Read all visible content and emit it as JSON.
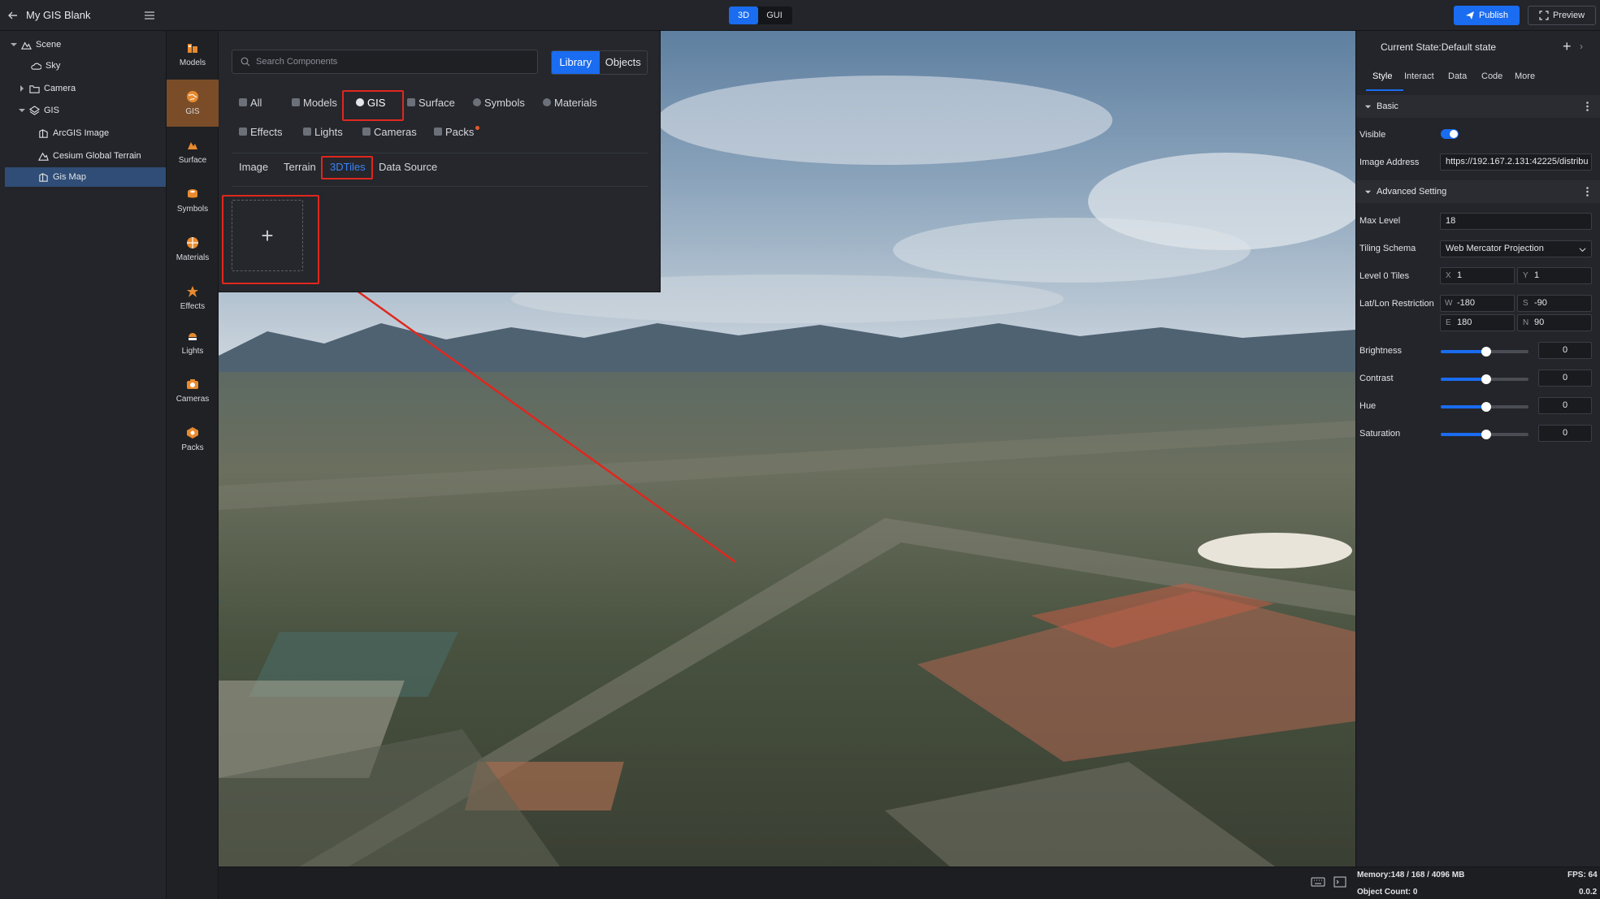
{
  "app": {
    "title": "My GIS Blank"
  },
  "mode": {
    "buttons": [
      "3D",
      "GUI"
    ],
    "active": "3D"
  },
  "toolbar": {
    "publish": "Publish",
    "preview": "Preview"
  },
  "tree": [
    {
      "label": "Scene",
      "icon": "scene-icon"
    },
    {
      "label": "Sky",
      "icon": "sky-icon"
    },
    {
      "label": "Camera",
      "icon": "folder-icon"
    },
    {
      "label": "GIS",
      "icon": "gis-icon"
    },
    {
      "label": "ArcGIS Image",
      "icon": "image-layer-icon"
    },
    {
      "label": "Cesium Global Terrain",
      "icon": "terrain-icon"
    },
    {
      "label": "Gis Map",
      "icon": "image-layer-icon",
      "selected": true
    }
  ],
  "rail": [
    {
      "label": "Models",
      "icon": "models-icon"
    },
    {
      "label": "GIS",
      "icon": "gis-icon",
      "active": true
    },
    {
      "label": "Surface",
      "icon": "surface-icon"
    },
    {
      "label": "Symbols",
      "icon": "symbols-icon"
    },
    {
      "label": "Materials",
      "icon": "materials-icon"
    },
    {
      "label": "Effects",
      "icon": "effects-icon"
    },
    {
      "label": "Lights",
      "icon": "lights-icon"
    },
    {
      "label": "Cameras",
      "icon": "cameras-icon"
    },
    {
      "label": "Packs",
      "icon": "packs-icon"
    }
  ],
  "panel": {
    "search_placeholder": "Search Components",
    "library_switch": [
      "Library",
      "Objects"
    ],
    "library_active": "Library",
    "categories_row1": [
      "All",
      "Models",
      "GIS",
      "Surface",
      "Symbols",
      "Materials"
    ],
    "categories_row2": [
      "Effects",
      "Lights",
      "Cameras",
      "Packs"
    ],
    "active_category": "GIS",
    "subtabs": [
      "Image",
      "Terrain",
      "3DTiles",
      "Data Source"
    ],
    "active_subtab": "3DTiles",
    "add_symbol": "+"
  },
  "props": {
    "state_label": "Current State:Default state",
    "tabs": [
      "Style",
      "Interact",
      "Data",
      "Code",
      "More"
    ],
    "active_tab": "Style",
    "basic": {
      "title": "Basic",
      "visible_label": "Visible",
      "visible": true,
      "image_address_label": "Image Address",
      "image_address": "https://192.167.2.131:42225/distribu"
    },
    "advanced": {
      "title": "Advanced Setting",
      "max_level_label": "Max Level",
      "max_level": "18",
      "tiling_schema_label": "Tiling Schema",
      "tiling_schema": "Web Mercator Projection",
      "level0_label": "Level 0 Tiles",
      "level0_x_prefix": "X",
      "level0_x": "1",
      "level0_y_prefix": "Y",
      "level0_y": "1",
      "latlon_label": "Lat/Lon Restriction",
      "w_prefix": "W",
      "w": "-180",
      "s_prefix": "S",
      "s": "-90",
      "e_prefix": "E",
      "e": "180",
      "n_prefix": "N",
      "n": "90",
      "brightness_label": "Brightness",
      "brightness": "0",
      "brightness_slider": 0.52,
      "contrast_label": "Contrast",
      "contrast": "0",
      "contrast_slider": 0.52,
      "hue_label": "Hue",
      "hue": "0",
      "hue_slider": 0.52,
      "saturation_label": "Saturation",
      "saturation": "0",
      "saturation_slider": 0.52
    }
  },
  "status": {
    "memory": "Memory:148 / 168 / 4096 MB",
    "fps": "FPS: 64",
    "object_count": "Object Count: 0",
    "version": "0.0.2"
  },
  "colors": {
    "accent": "#1a6cf0",
    "highlight": "#e0271e",
    "rail_active": "#7a4d28"
  }
}
